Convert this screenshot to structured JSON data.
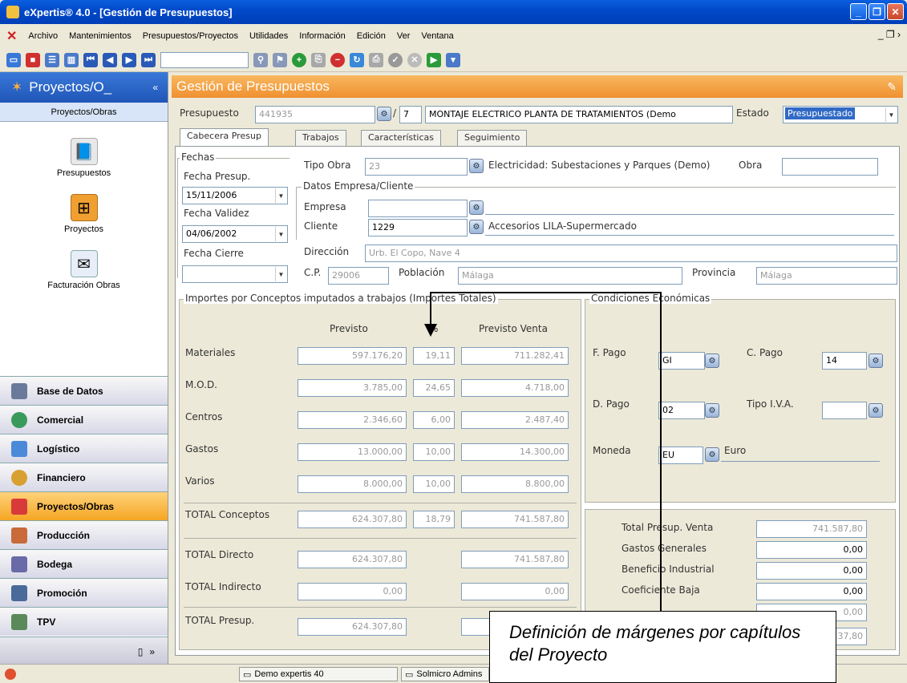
{
  "window": {
    "title": "eXpertis® 4.0 - [Gestión de Presupuestos]"
  },
  "menu": [
    "Archivo",
    "Mantenimientos",
    "Presupuestos/Proyectos",
    "Utilidades",
    "Información",
    "Edición",
    "Ver",
    "Ventana"
  ],
  "sidebar": {
    "header": "Proyectos/O_",
    "sub": "Proyectos/Obras",
    "items": [
      {
        "label": "Presupuestos",
        "icon": "book-icon"
      },
      {
        "label": "Proyectos",
        "icon": "project-icon"
      },
      {
        "label": "Facturación Obras",
        "icon": "envelope-check-icon"
      }
    ],
    "modules": [
      "Base de Datos",
      "Comercial",
      "Logístico",
      "Financiero",
      "Proyectos/Obras",
      "Producción",
      "Bodega",
      "Promoción",
      "TPV"
    ],
    "active_module": "Proyectos/Obras",
    "footer_more": "»"
  },
  "form": {
    "title": "Gestión de Presupuestos",
    "presupuesto_label": "Presupuesto",
    "presupuesto_value": "441935",
    "presupuesto_version": "7",
    "descripcion": "MONTAJE ELECTRICO PLANTA DE TRATAMIENTOS (Demo",
    "estado_label": "Estado",
    "estado_value": "Presupuestado",
    "tabs": [
      "Cabecera Presup",
      "Trabajos",
      "Características",
      "Seguimiento"
    ],
    "fechas": {
      "group": "Fechas",
      "presup_label": "Fecha Presup.",
      "presup_value": "15/11/2006",
      "validez_label": "Fecha Validez",
      "validez_value": "04/06/2002",
      "cierre_label": "Fecha Cierre",
      "cierre_value": ""
    },
    "tipo_obra_label": "Tipo Obra",
    "tipo_obra_value": "23",
    "tipo_obra_desc": "Electricidad: Subestaciones y Parques (Demo)",
    "obra_label": "Obra",
    "cliente_group": "Datos Empresa/Cliente",
    "empresa_label": "Empresa",
    "cliente_label": "Cliente",
    "cliente_value": "1229",
    "cliente_desc": "Accesorios LILA-Supermercado",
    "direccion_label": "Dirección",
    "direccion_value": "Urb. El Copo, Nave 4",
    "cp_label": "C.P.",
    "cp_value": "29006",
    "poblacion_label": "Población",
    "poblacion_value": "Málaga",
    "provincia_label": "Provincia",
    "provincia_value": "Málaga"
  },
  "importes": {
    "group": "Importes por Conceptos imputados a trabajos (Importes Totales)",
    "col_previsto": "Previsto",
    "col_pct": "%",
    "col_venta": "Previsto Venta",
    "rows": [
      {
        "label": "Materiales",
        "previsto": "597.176,20",
        "pct": "19,11",
        "venta": "711.282,41"
      },
      {
        "label": "M.O.D.",
        "previsto": "3.785,00",
        "pct": "24,65",
        "venta": "4.718,00"
      },
      {
        "label": "Centros",
        "previsto": "2.346,60",
        "pct": "6,00",
        "venta": "2.487,40"
      },
      {
        "label": "Gastos",
        "previsto": "13.000,00",
        "pct": "10,00",
        "venta": "14.300,00"
      },
      {
        "label": "Varios",
        "previsto": "8.000,00",
        "pct": "10,00",
        "venta": "8.800,00"
      }
    ],
    "total_conceptos": {
      "label": "TOTAL Conceptos",
      "previsto": "624.307,80",
      "pct": "18,79",
      "venta": "741.587,80"
    },
    "total_directo": {
      "label": "TOTAL Directo",
      "previsto": "624.307,80",
      "venta": "741.587,80"
    },
    "total_indirecto": {
      "label": "TOTAL Indirecto",
      "previsto": "0,00",
      "venta": "0,00"
    },
    "total_presup": {
      "label": "TOTAL Presup.",
      "previsto": "624.307,80"
    }
  },
  "condiciones": {
    "group": "Condiciones Económicas",
    "fpago_label": "F. Pago",
    "fpago_value": "GI",
    "cpago_label": "C. Pago",
    "cpago_value": "14",
    "dpago_label": "D. Pago",
    "dpago_value": "02",
    "iva_label": "Tipo I.V.A.",
    "iva_value": "",
    "moneda_label": "Moneda",
    "moneda_value": "EU",
    "moneda_desc": "Euro"
  },
  "totales": {
    "venta_label": "Total Presup. Venta",
    "venta_value": "741.587,80",
    "gastos_label": "Gastos Generales",
    "gastos_value": "0,00",
    "beneficio_label": "Beneficio Industrial",
    "beneficio_value": "0,00",
    "coef_label": "Coeficiente Baja",
    "coef_value": "0,00",
    "iva_value": "0,00",
    "final_value": "37,80"
  },
  "statusbar": {
    "task1": "Demo expertis 40",
    "task2": "Solmicro Admins"
  },
  "annotation": "Definición de márgenes por capítulos del Proyecto"
}
